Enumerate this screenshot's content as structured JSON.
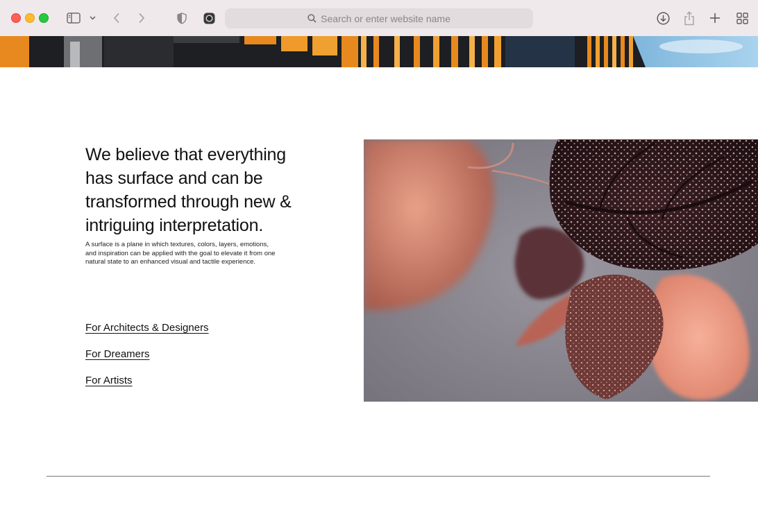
{
  "browser": {
    "address_placeholder": "Search or enter website name",
    "icons": [
      "sidebar-icon",
      "chevron-down-icon",
      "back-icon",
      "forward-icon",
      "shield-icon",
      "extension-icon",
      "search-icon",
      "download-icon",
      "share-icon",
      "plus-icon",
      "tab-overview-icon"
    ]
  },
  "main": {
    "headline": "We believe that everything has surface and can be transformed through new & intriguing interpretation.",
    "description": "A surface is a plane in which textures, colors, layers, emotions, and inspiration can be applied with the goal to elevate it from one natural state to an enhanced visual and tactile experience.",
    "links": [
      {
        "label": "For Architects & Designers"
      },
      {
        "label": "For Dreamers"
      },
      {
        "label": "For Artists"
      }
    ]
  },
  "colors": {
    "toolbar": "#efe9ec",
    "close": "#ff5f57",
    "minimize": "#febc2e",
    "maximize": "#28c840",
    "accent_orange": "#e8891f"
  }
}
